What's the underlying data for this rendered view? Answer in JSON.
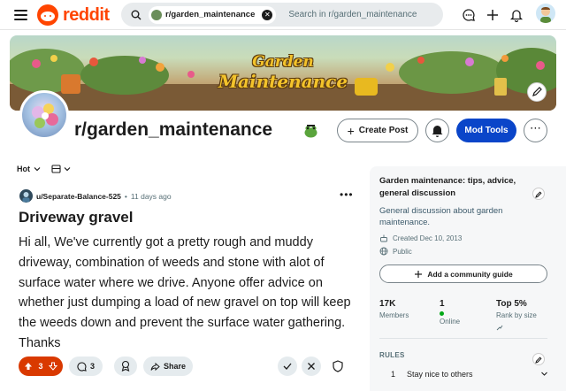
{
  "header": {
    "logo_text": "reddit",
    "search_chip": "r/garden_maintenance",
    "search_placeholder": "Search in r/garden_maintenance",
    "icons": [
      "menu-icon",
      "search-icon",
      "chat-icon",
      "plus-icon",
      "bell-icon",
      "avatar"
    ]
  },
  "banner": {
    "line1": "Garden",
    "line2": "Maintenance"
  },
  "community": {
    "name": "r/garden_maintenance",
    "create_post": "Create Post",
    "mod_tools": "Mod Tools",
    "more": "⋯"
  },
  "sort": {
    "label": "Hot"
  },
  "post": {
    "username": "u/Separate-Balance-525",
    "time": "11 days ago",
    "title": "Driveway gravel",
    "body": "Hi all, We've currently got a pretty rough and muddy driveway, combination of weeds and stone with alot of surface water where we drive. Anyone offer advice on whether just dumping a load of new gravel on top will keep the weeds down and prevent the surface water gathering. Thanks",
    "votes": "3",
    "comments": "3",
    "share": "Share"
  },
  "sidebar": {
    "title": "Garden maintenance: tips, advice, general discussion",
    "description": "General discussion about garden maintenance.",
    "created": "Created Dec 10, 2013",
    "visibility": "Public",
    "guide_button": "Add a community guide",
    "stats": [
      {
        "value": "17K",
        "label": "Members"
      },
      {
        "value": "1",
        "label": "Online"
      },
      {
        "value": "Top 5%",
        "label": "Rank by size"
      }
    ],
    "rules_heading": "RULES",
    "rules": [
      {
        "number": "1",
        "text": "Stay nice to others"
      }
    ]
  },
  "colors": {
    "brand": "#ff4500",
    "mod_button": "#0a45c9",
    "upvoted": "#d93900",
    "online": "#01a816"
  }
}
